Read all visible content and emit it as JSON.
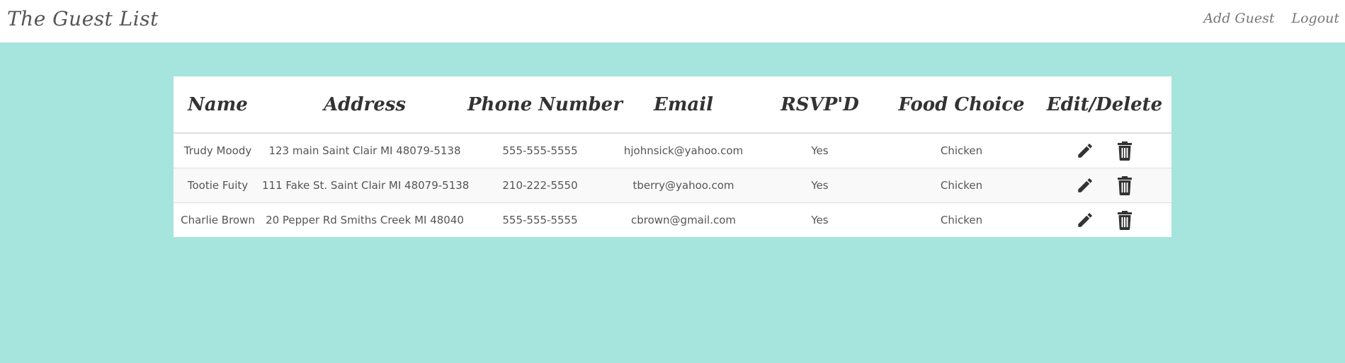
{
  "navbar": {
    "brand": "The Guest List",
    "links": [
      "Add Guest",
      "Logout"
    ]
  },
  "table": {
    "headers": [
      "Name",
      "Address",
      "Phone Number",
      "Email",
      "RSVP'D",
      "Food Choice",
      "Edit/Delete"
    ],
    "rows": [
      {
        "name": "Trudy Moody",
        "address": "123 main Saint Clair MI 48079-5138",
        "phone": "555-555-5555",
        "email": "hjohnsick@yahoo.com",
        "rsvp": "Yes",
        "food": "Chicken"
      },
      {
        "name": "Tootie Fuity",
        "address": "111 Fake St. Saint Clair MI 48079-5138",
        "phone": "210-222-5550",
        "email": "tberry@yahoo.com",
        "rsvp": "Yes",
        "food": "Chicken"
      },
      {
        "name": "Charlie Brown",
        "address": "20 Pepper Rd Smiths Creek MI 48040",
        "phone": "555-555-5555",
        "email": "cbrown@gmail.com",
        "rsvp": "Yes",
        "food": "Chicken"
      }
    ]
  },
  "icons": {
    "edit": "pencil-icon",
    "delete": "trash-icon"
  },
  "colors": {
    "background": "#a6e4de",
    "navbar": "#ffffff",
    "text": "#555555",
    "icon": "#333333"
  }
}
